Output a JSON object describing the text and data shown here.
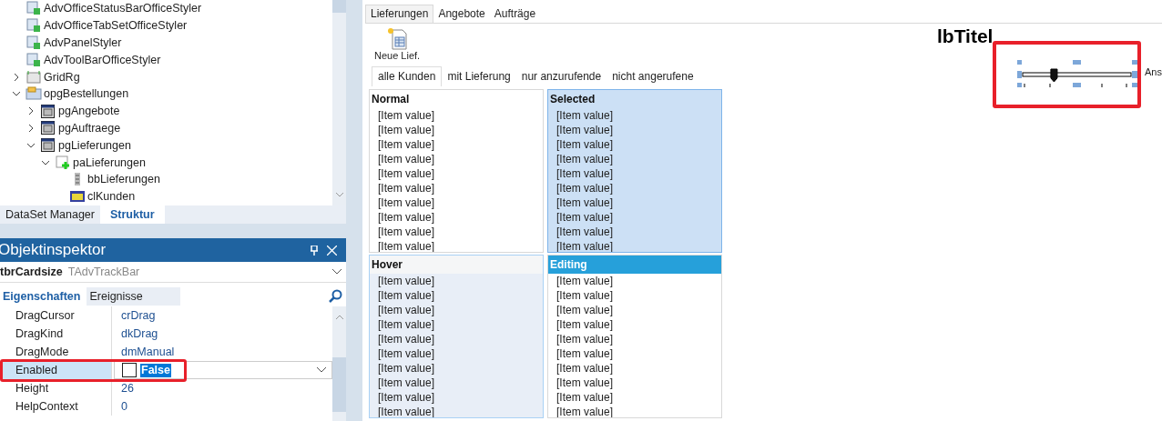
{
  "structure": {
    "tree": [
      {
        "label": "AdvOfficeStatusBarOfficeStyler",
        "kind": "styler"
      },
      {
        "label": "AdvOfficeTabSetOfficeStyler",
        "kind": "styler"
      },
      {
        "label": "AdvPanelStyler",
        "kind": "styler"
      },
      {
        "label": "AdvToolBarOfficeStyler",
        "kind": "styler"
      },
      {
        "label": "GridRg",
        "kind": "grid",
        "expanded": false
      },
      {
        "label": "opgBestellungen",
        "kind": "pages",
        "expanded": true,
        "children": [
          {
            "label": "pgAngebote",
            "kind": "page",
            "expanded": false
          },
          {
            "label": "pgAuftraege",
            "kind": "page",
            "expanded": false
          },
          {
            "label": "pgLieferungen",
            "kind": "page",
            "expanded": true,
            "children": [
              {
                "label": "paLieferungen",
                "kind": "panel",
                "expanded": true,
                "children": [
                  {
                    "label": "bbLieferungen",
                    "kind": "bar"
                  },
                  {
                    "label": "clKunden",
                    "kind": "list"
                  }
                ]
              }
            ]
          }
        ]
      }
    ],
    "tabs": [
      {
        "label": "DataSet Manager",
        "selected": false
      },
      {
        "label": "Struktur",
        "selected": true
      }
    ]
  },
  "object_inspector": {
    "title": "Objektinspektor",
    "object_name": "tbrCardsize",
    "object_type": "TAdvTrackBar",
    "tabs": [
      {
        "label": "Eigenschaften",
        "selected": true
      },
      {
        "label": "Ereignisse",
        "selected": false
      }
    ],
    "properties": [
      {
        "name": "DragCursor",
        "value": "crDrag",
        "kind": "text",
        "selected": false
      },
      {
        "name": "DragKind",
        "value": "dkDrag",
        "kind": "text",
        "selected": false
      },
      {
        "name": "DragMode",
        "value": "dmManual",
        "kind": "text",
        "selected": false
      },
      {
        "name": "Enabled",
        "value": "False",
        "kind": "bool",
        "checked": false,
        "selected": true
      },
      {
        "name": "Height",
        "value": "26",
        "kind": "text",
        "selected": false
      },
      {
        "name": "HelpContext",
        "value": "0",
        "kind": "text",
        "selected": false
      }
    ]
  },
  "designer": {
    "tabs": [
      {
        "label": "Lieferungen",
        "selected": true
      },
      {
        "label": "Angebote",
        "selected": false
      },
      {
        "label": "Aufträge",
        "selected": false
      }
    ],
    "toolbar_button": "Neue Lief.",
    "filter_tabs": [
      {
        "label": "alle Kunden",
        "selected": true
      },
      {
        "label": "mit Lieferung",
        "selected": false
      },
      {
        "label": "nur anzurufende",
        "selected": false
      },
      {
        "label": "nicht angerufene",
        "selected": false
      }
    ],
    "lists": [
      {
        "title": "Normal",
        "kind": "normal",
        "items": [
          "[Item value]",
          "[Item value]",
          "[Item value]",
          "[Item value]",
          "[Item value]",
          "[Item value]",
          "[Item value]",
          "[Item value]",
          "[Item value]",
          "[Item value]"
        ]
      },
      {
        "title": "Selected",
        "kind": "selected",
        "items": [
          "[Item value]",
          "[Item value]",
          "[Item value]",
          "[Item value]",
          "[Item value]",
          "[Item value]",
          "[Item value]",
          "[Item value]",
          "[Item value]",
          "[Item value]"
        ]
      },
      {
        "title": "Hover",
        "kind": "hover",
        "items": [
          "[Item value]",
          "[Item value]",
          "[Item value]",
          "[Item value]",
          "[Item value]",
          "[Item value]",
          "[Item value]",
          "[Item value]",
          "[Item value]",
          "[Item value]"
        ]
      },
      {
        "title": "Editing",
        "kind": "editing",
        "items": [
          "[Item value]",
          "[Item value]",
          "[Item value]",
          "[Item value]",
          "[Item value]",
          "[Item value]",
          "[Item value]",
          "[Item value]",
          "[Item value]",
          "[Item value]"
        ]
      }
    ],
    "title_label": "lbTitel",
    "trackbar": {
      "level": 0.27
    },
    "side_label": "Ans"
  }
}
